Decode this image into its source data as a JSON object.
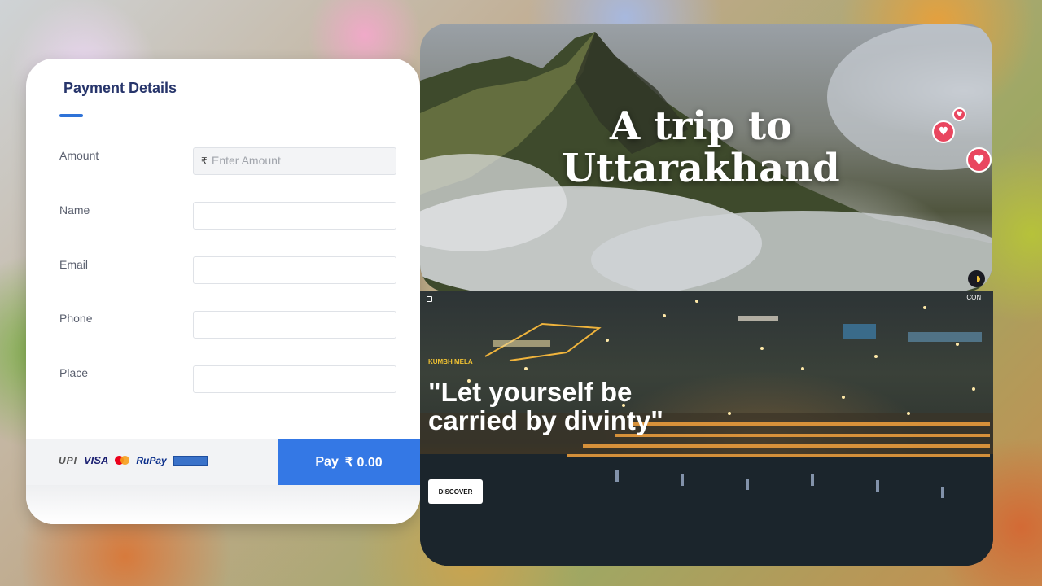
{
  "payment": {
    "title": "Payment Details",
    "fields": [
      {
        "label": "Amount",
        "currency": "₹",
        "placeholder": "Enter Amount",
        "value": ""
      },
      {
        "label": "Name",
        "value": ""
      },
      {
        "label": "Email",
        "value": ""
      },
      {
        "label": "Phone",
        "value": ""
      },
      {
        "label": "Place",
        "value": ""
      }
    ],
    "logos": {
      "upi": "UPI",
      "visa": "VISA",
      "rupay": "RuPay"
    },
    "pay_button": {
      "label": "Pay",
      "amount": "₹ 0.00"
    }
  },
  "trip": {
    "title_line1": "A trip to",
    "title_line2": "Uttarakhand"
  },
  "kumbh": {
    "tag": "KUMBH MELA",
    "quote": "\"Let yourself be carried by divinty\"",
    "discover_label": "DISCOVER",
    "corner_text": "CONT"
  },
  "colors": {
    "accent": "#3478e5",
    "heart": "#e9465f",
    "tag": "#f1c232",
    "title": "#27356b"
  }
}
